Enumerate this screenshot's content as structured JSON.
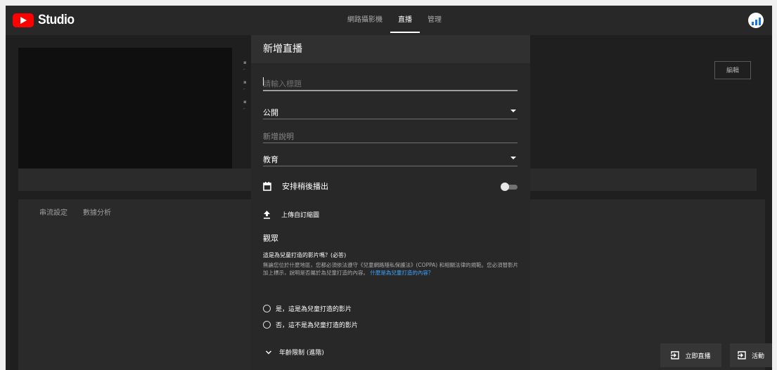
{
  "topbar": {
    "logo_text": "Studio",
    "tabs": [
      {
        "label": "網路攝影機"
      },
      {
        "label": "直播"
      },
      {
        "label": "管理"
      }
    ]
  },
  "background": {
    "edit_button": "編輯",
    "lower_tabs": [
      {
        "label": "串流設定"
      },
      {
        "label": "數據分析"
      }
    ]
  },
  "modal": {
    "title": "新增直播",
    "title_placeholder": "請輸入標題",
    "visibility": "公開",
    "description_placeholder": "新增說明",
    "category": "教育",
    "schedule_label": "安排稍後播出",
    "schedule_enabled": false,
    "upload_thumbnail": "上傳自訂縮圖",
    "audience_title": "觀眾",
    "kids_question": "這是為兒童打造的影片嗎？(必答)",
    "kids_description": "無論您位於什麼地區，您都必須依法遵守《兒童網路隱私保護法》(COPPA) 和相關法律的規範。您必須替影片加上標示，說明是否屬於為兒童打造的內容。",
    "kids_link": "什麼是為兒童打造的內容？",
    "option_yes": "是，這是為兒童打造的影片",
    "option_no": "否，這不是為兒童打造的影片",
    "age_restriction": "年齡限制 (進階)"
  },
  "bottom_buttons": {
    "go_live": "立即直播",
    "events": "活動"
  }
}
